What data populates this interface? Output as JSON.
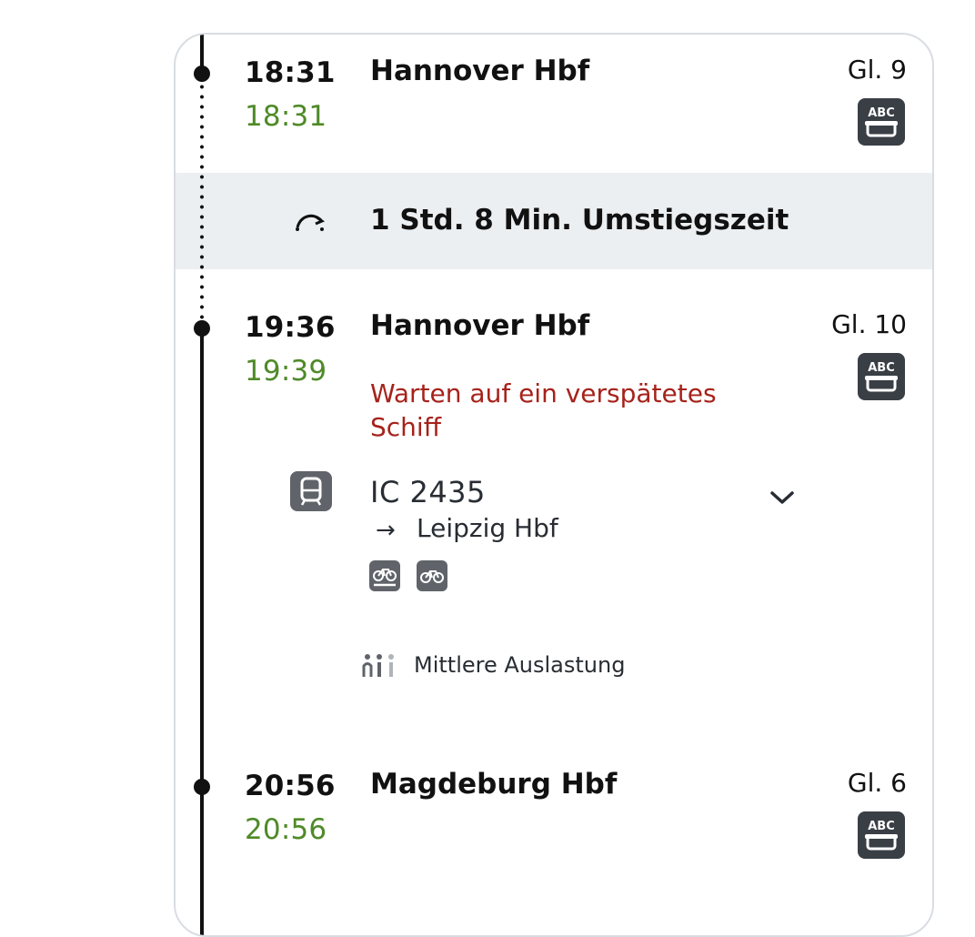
{
  "stops": [
    {
      "planned_time": "18:31",
      "actual_time": "18:31",
      "station": "Hannover Hbf",
      "track": "Gl. 9",
      "seat_icon": "seat-reservation-abc-icon"
    },
    {
      "planned_time": "19:36",
      "actual_time": "19:39",
      "station": "Hannover Hbf",
      "track": "Gl. 10",
      "seat_icon": "seat-reservation-abc-icon"
    },
    {
      "planned_time": "20:56",
      "actual_time": "20:56",
      "station": "Magdeburg Hbf",
      "track": "Gl. 6",
      "seat_icon": "seat-reservation-abc-icon"
    }
  ],
  "transfer": {
    "icon": "transfer-arrow-icon",
    "text": "1 Std. 8 Min. Umstiegszeit"
  },
  "delay_reason": "Warten auf ein verspätetes Schiff",
  "train": {
    "icon": "train-icon",
    "name": "IC 2435",
    "direction_arrow": "→",
    "destination": "Leipzig Hbf",
    "amenity_icons": [
      "bike-reservation-required-icon",
      "bike-transport-icon"
    ],
    "expand_icon": "chevron-down-icon"
  },
  "occupancy": {
    "icon": "occupancy-medium-icon",
    "label": "Mittlere Auslastung"
  },
  "colors": {
    "on_time": "#4f8a28",
    "delay_text": "#a6221b",
    "transfer_band": "#eceff2",
    "icon_dark": "#3a3f46",
    "icon_grey": "#60646a"
  }
}
